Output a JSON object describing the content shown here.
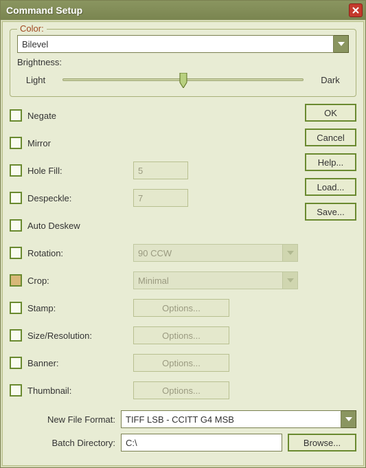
{
  "window": {
    "title": "Command Setup"
  },
  "color_group": {
    "title": "Color:",
    "value": "Bilevel",
    "brightness_label": "Brightness:",
    "light_label": "Light",
    "dark_label": "Dark"
  },
  "buttons": {
    "ok": "OK",
    "cancel": "Cancel",
    "help": "Help...",
    "load": "Load...",
    "save": "Save...",
    "browse": "Browse..."
  },
  "checks": {
    "negate": "Negate",
    "mirror": "Mirror",
    "hole_fill": "Hole Fill:",
    "despeckle": "Despeckle:",
    "auto_deskew": "Auto Deskew",
    "rotation": "Rotation:",
    "crop": "Crop:",
    "stamp": "Stamp:",
    "size_res": "Size/Resolution:",
    "banner": "Banner:",
    "thumbnail": "Thumbnail:"
  },
  "values": {
    "hole_fill": "5",
    "despeckle": "7",
    "rotation": "90 CCW",
    "crop": "Minimal",
    "options": "Options..."
  },
  "bottom": {
    "file_format_label": "New File Format:",
    "file_format_value": "TIFF LSB - CCITT G4 MSB",
    "batch_dir_label": "Batch Directory:",
    "batch_dir_value": "C:\\"
  }
}
